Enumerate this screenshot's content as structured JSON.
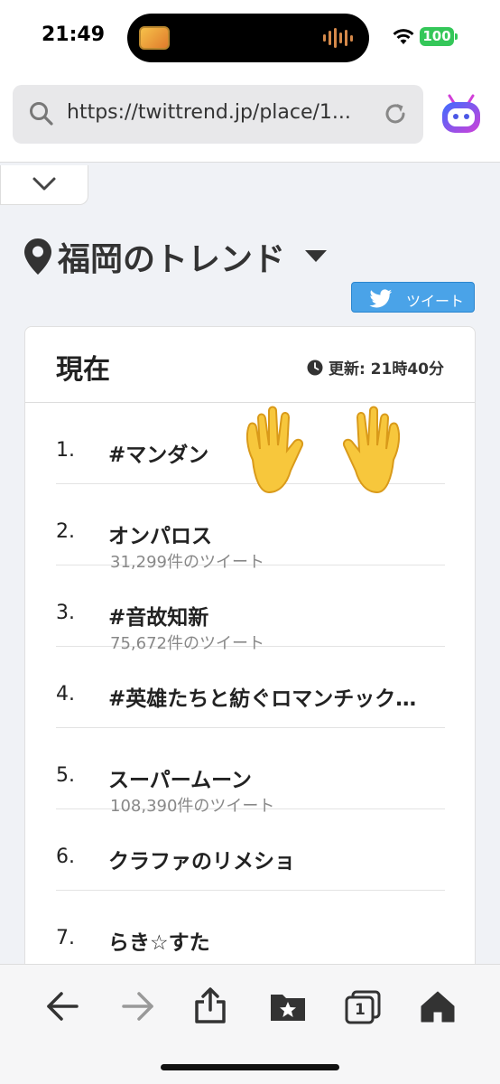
{
  "status": {
    "time": "21:49",
    "battery": "100"
  },
  "browser": {
    "url": "https://twittrend.jp/place/1..."
  },
  "page": {
    "title": "福岡のトレンド",
    "tweet_button": "ツイート",
    "card": {
      "heading": "現在",
      "updated": "更新: 21時40分",
      "items": [
        {
          "rank": "1.",
          "name": "#マンダン",
          "count": ""
        },
        {
          "rank": "2.",
          "name": "オンパロス",
          "count": "31,299件のツイート"
        },
        {
          "rank": "3.",
          "name": "#音故知新",
          "count": "75,672件のツイート"
        },
        {
          "rank": "4.",
          "name": "#英雄たちと紡ぐロマンチック…",
          "count": ""
        },
        {
          "rank": "5.",
          "name": "スーパームーン",
          "count": "108,390件のツイート"
        },
        {
          "rank": "6.",
          "name": "クラファのリメショ",
          "count": ""
        },
        {
          "rank": "7.",
          "name": "らき☆すた",
          "count": ""
        }
      ]
    }
  },
  "toolbar": {
    "tabs_count": "1"
  },
  "colors": {
    "accent": "#4aa3e8",
    "battery": "#34c759"
  }
}
